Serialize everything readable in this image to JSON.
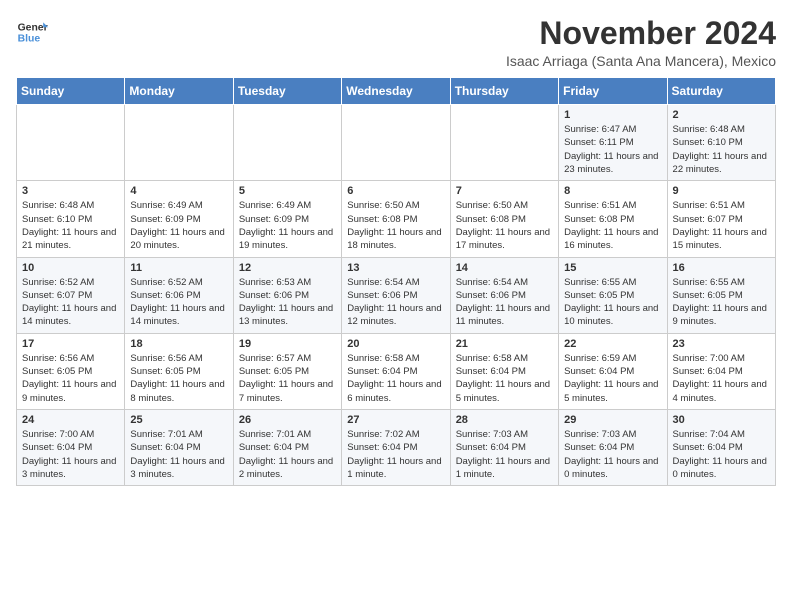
{
  "header": {
    "logo_line1": "General",
    "logo_line2": "Blue",
    "month_title": "November 2024",
    "subtitle": "Isaac Arriaga (Santa Ana Mancera), Mexico"
  },
  "weekdays": [
    "Sunday",
    "Monday",
    "Tuesday",
    "Wednesday",
    "Thursday",
    "Friday",
    "Saturday"
  ],
  "weeks": [
    [
      {
        "day": "",
        "info": ""
      },
      {
        "day": "",
        "info": ""
      },
      {
        "day": "",
        "info": ""
      },
      {
        "day": "",
        "info": ""
      },
      {
        "day": "",
        "info": ""
      },
      {
        "day": "1",
        "info": "Sunrise: 6:47 AM\nSunset: 6:11 PM\nDaylight: 11 hours and 23 minutes."
      },
      {
        "day": "2",
        "info": "Sunrise: 6:48 AM\nSunset: 6:10 PM\nDaylight: 11 hours and 22 minutes."
      }
    ],
    [
      {
        "day": "3",
        "info": "Sunrise: 6:48 AM\nSunset: 6:10 PM\nDaylight: 11 hours and 21 minutes."
      },
      {
        "day": "4",
        "info": "Sunrise: 6:49 AM\nSunset: 6:09 PM\nDaylight: 11 hours and 20 minutes."
      },
      {
        "day": "5",
        "info": "Sunrise: 6:49 AM\nSunset: 6:09 PM\nDaylight: 11 hours and 19 minutes."
      },
      {
        "day": "6",
        "info": "Sunrise: 6:50 AM\nSunset: 6:08 PM\nDaylight: 11 hours and 18 minutes."
      },
      {
        "day": "7",
        "info": "Sunrise: 6:50 AM\nSunset: 6:08 PM\nDaylight: 11 hours and 17 minutes."
      },
      {
        "day": "8",
        "info": "Sunrise: 6:51 AM\nSunset: 6:08 PM\nDaylight: 11 hours and 16 minutes."
      },
      {
        "day": "9",
        "info": "Sunrise: 6:51 AM\nSunset: 6:07 PM\nDaylight: 11 hours and 15 minutes."
      }
    ],
    [
      {
        "day": "10",
        "info": "Sunrise: 6:52 AM\nSunset: 6:07 PM\nDaylight: 11 hours and 14 minutes."
      },
      {
        "day": "11",
        "info": "Sunrise: 6:52 AM\nSunset: 6:06 PM\nDaylight: 11 hours and 14 minutes."
      },
      {
        "day": "12",
        "info": "Sunrise: 6:53 AM\nSunset: 6:06 PM\nDaylight: 11 hours and 13 minutes."
      },
      {
        "day": "13",
        "info": "Sunrise: 6:54 AM\nSunset: 6:06 PM\nDaylight: 11 hours and 12 minutes."
      },
      {
        "day": "14",
        "info": "Sunrise: 6:54 AM\nSunset: 6:06 PM\nDaylight: 11 hours and 11 minutes."
      },
      {
        "day": "15",
        "info": "Sunrise: 6:55 AM\nSunset: 6:05 PM\nDaylight: 11 hours and 10 minutes."
      },
      {
        "day": "16",
        "info": "Sunrise: 6:55 AM\nSunset: 6:05 PM\nDaylight: 11 hours and 9 minutes."
      }
    ],
    [
      {
        "day": "17",
        "info": "Sunrise: 6:56 AM\nSunset: 6:05 PM\nDaylight: 11 hours and 9 minutes."
      },
      {
        "day": "18",
        "info": "Sunrise: 6:56 AM\nSunset: 6:05 PM\nDaylight: 11 hours and 8 minutes."
      },
      {
        "day": "19",
        "info": "Sunrise: 6:57 AM\nSunset: 6:05 PM\nDaylight: 11 hours and 7 minutes."
      },
      {
        "day": "20",
        "info": "Sunrise: 6:58 AM\nSunset: 6:04 PM\nDaylight: 11 hours and 6 minutes."
      },
      {
        "day": "21",
        "info": "Sunrise: 6:58 AM\nSunset: 6:04 PM\nDaylight: 11 hours and 5 minutes."
      },
      {
        "day": "22",
        "info": "Sunrise: 6:59 AM\nSunset: 6:04 PM\nDaylight: 11 hours and 5 minutes."
      },
      {
        "day": "23",
        "info": "Sunrise: 7:00 AM\nSunset: 6:04 PM\nDaylight: 11 hours and 4 minutes."
      }
    ],
    [
      {
        "day": "24",
        "info": "Sunrise: 7:00 AM\nSunset: 6:04 PM\nDaylight: 11 hours and 3 minutes."
      },
      {
        "day": "25",
        "info": "Sunrise: 7:01 AM\nSunset: 6:04 PM\nDaylight: 11 hours and 3 minutes."
      },
      {
        "day": "26",
        "info": "Sunrise: 7:01 AM\nSunset: 6:04 PM\nDaylight: 11 hours and 2 minutes."
      },
      {
        "day": "27",
        "info": "Sunrise: 7:02 AM\nSunset: 6:04 PM\nDaylight: 11 hours and 1 minute."
      },
      {
        "day": "28",
        "info": "Sunrise: 7:03 AM\nSunset: 6:04 PM\nDaylight: 11 hours and 1 minute."
      },
      {
        "day": "29",
        "info": "Sunrise: 7:03 AM\nSunset: 6:04 PM\nDaylight: 11 hours and 0 minutes."
      },
      {
        "day": "30",
        "info": "Sunrise: 7:04 AM\nSunset: 6:04 PM\nDaylight: 11 hours and 0 minutes."
      }
    ]
  ]
}
